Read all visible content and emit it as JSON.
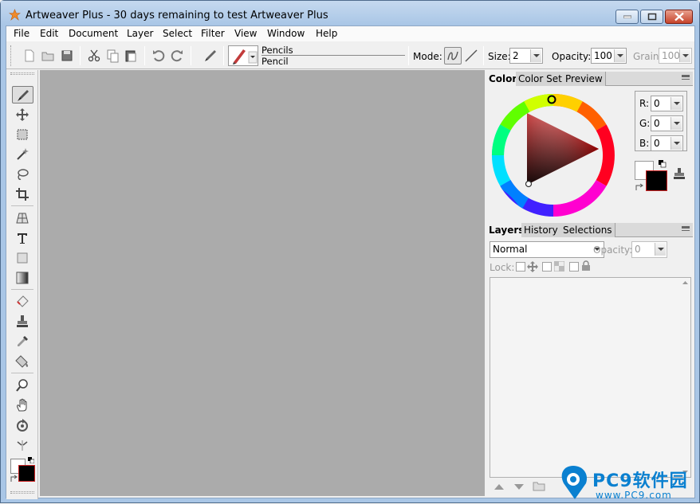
{
  "window": {
    "title": "Artweaver Plus - 30 days remaining to test Artweaver Plus"
  },
  "menu": [
    "File",
    "Edit",
    "Document",
    "Layer",
    "Select",
    "Filter",
    "View",
    "Window",
    "Help"
  ],
  "options_bar": {
    "brush_category": "Pencils",
    "brush_name": "Pencil",
    "mode_label": "Mode:",
    "size_label": "Size:",
    "size_value": "2",
    "opacity_label": "Opacity:",
    "opacity_value": "100",
    "grain_label": "Grain:",
    "grain_value": "100"
  },
  "color_panel": {
    "tabs": [
      "Color",
      "Color Set",
      "Preview"
    ],
    "r_label": "R:",
    "r_value": "0",
    "g_label": "G:",
    "g_value": "0",
    "b_label": "B:",
    "b_value": "0",
    "foreground": "#000000",
    "background": "#ffffff"
  },
  "layers_panel": {
    "tabs": [
      "Layers",
      "History",
      "Selections"
    ],
    "blend_mode": "Normal",
    "opacity_label": "Opacity:",
    "opacity_value": "0",
    "lock_label": "Lock:"
  },
  "watermark": {
    "brand": "PC9软件园",
    "url": "www.PC9.com"
  }
}
